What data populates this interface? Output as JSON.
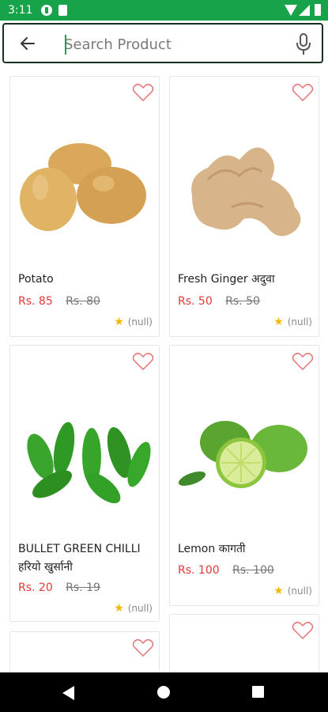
{
  "status_bar": {
    "time": "3:11"
  },
  "search": {
    "placeholder": "Search Product",
    "value": ""
  },
  "products": [
    {
      "name": "Potato",
      "price": "Rs. 85",
      "mrp": "Rs. 80",
      "rating": "(null)"
    },
    {
      "name": "Fresh Ginger अदुवा",
      "price": "Rs. 50",
      "mrp": "Rs. 50",
      "rating": "(null)"
    },
    {
      "name": "BULLET GREEN CHILLI हरियो खुर्सानी",
      "price": "Rs. 20",
      "mrp": "Rs. 19",
      "rating": "(null)"
    },
    {
      "name": "Lemon कागती",
      "price": "Rs. 100",
      "mrp": "Rs. 100",
      "rating": "(null)"
    }
  ],
  "icons": {
    "back": "arrow-left-icon",
    "mic": "microphone-icon",
    "wishlist": "heart-icon",
    "rating": "star-icon"
  },
  "colors": {
    "status_bar": "#16a34a",
    "price": "#e53935",
    "heart": "#e57373",
    "star": "#f5b800"
  }
}
